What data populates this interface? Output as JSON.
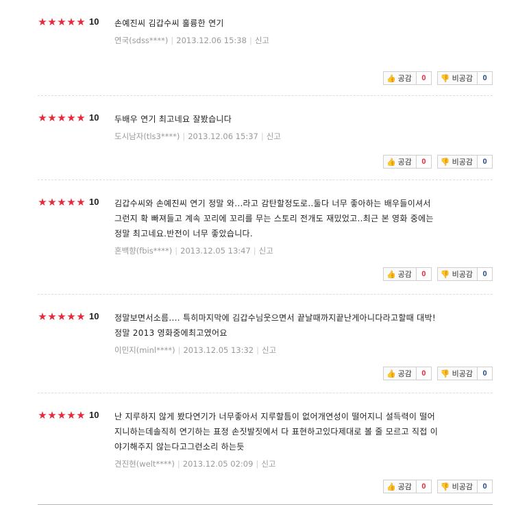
{
  "reviews": [
    {
      "score": "10",
      "text": [
        "손예진씨 김갑수씨 훌륭한 연기"
      ],
      "author": "연국(sdss****)",
      "date": "2013.12.06 15:38",
      "report_label": "신고",
      "agree_label": "공감",
      "agree_count": "0",
      "disagree_label": "비공감",
      "disagree_count": "0"
    },
    {
      "score": "10",
      "text": [
        "두배우 연기 최고네요 잘봤습니다"
      ],
      "author": "도시남자(tls3****)",
      "date": "2013.12.06 15:37",
      "report_label": "신고",
      "agree_label": "공감",
      "agree_count": "0",
      "disagree_label": "비공감",
      "disagree_count": "0"
    },
    {
      "score": "10",
      "text": [
        "김갑수씨와 손예진씨 연기 정말 와...라고 감탄할정도로..둘다 너무 좋아하는 배우들이셔서",
        "그런지 확 빠져들고 계속 꼬리에 꼬리를 무는 스토리 전개도 재밌었고..최근 본 영화 중에는",
        "정말 최고네요.반전이 너무 좋았습니다."
      ],
      "author": "혼백향(fbis****)",
      "date": "2013.12.05 13:47",
      "report_label": "신고",
      "agree_label": "공감",
      "agree_count": "0",
      "disagree_label": "비공감",
      "disagree_count": "0"
    },
    {
      "score": "10",
      "text": [
        "정말보면서소름.... 특히마지막에 김갑수님웃으면서 끝날때까지끝난게아니다라고할때 대박!",
        "정말 2013 영화중에최고였어요"
      ],
      "author": "이민지(minl****)",
      "date": "2013.12.05 13:32",
      "report_label": "신고",
      "agree_label": "공감",
      "agree_count": "0",
      "disagree_label": "비공감",
      "disagree_count": "0"
    },
    {
      "score": "10",
      "text": [
        "난 지루하지 않게 봤다연기가 너무좋아서 지루할틈이 없어개연성이 떨어지니 설득력이 떨어",
        "지니하는데솔직히 연기하는 표정 손짓발짓에서 다 표현하고있다제대로 볼 줄 모르고 직접 이",
        "야기해주지 않는다고그런소리 하는듯"
      ],
      "author": "견진현(welt****)",
      "date": "2013.12.05 02:09",
      "report_label": "신고",
      "agree_label": "공감",
      "agree_count": "0",
      "disagree_label": "비공감",
      "disagree_count": "0"
    }
  ]
}
